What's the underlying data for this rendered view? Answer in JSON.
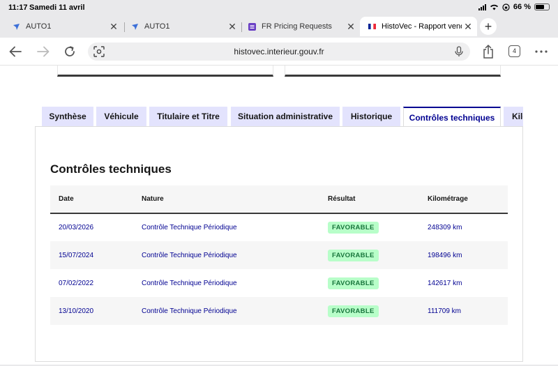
{
  "status": {
    "time": "11:17",
    "date": "Samedi 11 avril",
    "battery": "66 %",
    "battery_level": 0.66
  },
  "browser_tabs": [
    {
      "title": "AUTO1",
      "icon": "auto1-favicon"
    },
    {
      "title": "AUTO1",
      "icon": "auto1-favicon"
    },
    {
      "title": "FR Pricing Requests",
      "icon": "forms-favicon"
    },
    {
      "title": "HistoVec - Rapport vend",
      "icon": "french-flag-favicon",
      "active": true
    }
  ],
  "address": {
    "url": "histovec.interieur.gouv.fr",
    "tab_count": "4"
  },
  "page_tabs": [
    "Synthèse",
    "Véhicule",
    "Titulaire et Titre",
    "Situation administrative",
    "Historique",
    "Contrôles techniques",
    "Kilo"
  ],
  "section": {
    "title": "Contrôles techniques",
    "columns": [
      "Date",
      "Nature",
      "Résultat",
      "Kilométrage"
    ],
    "rows": [
      {
        "date": "20/03/2026",
        "nature": "Contrôle Technique Périodique",
        "result": "FAVORABLE",
        "km": "248309 km"
      },
      {
        "date": "15/07/2024",
        "nature": "Contrôle Technique Périodique",
        "result": "FAVORABLE",
        "km": "198496 km"
      },
      {
        "date": "07/02/2022",
        "nature": "Contrôle Technique Périodique",
        "result": "FAVORABLE",
        "km": "142617 km"
      },
      {
        "date": "13/10/2020",
        "nature": "Contrôle Technique Périodique",
        "result": "FAVORABLE",
        "km": "111709 km"
      }
    ]
  },
  "colors": {
    "accent": "#000091",
    "tab_bg": "#e3e3fd",
    "badge_bg": "#b8fec9",
    "badge_text": "#18753c"
  }
}
